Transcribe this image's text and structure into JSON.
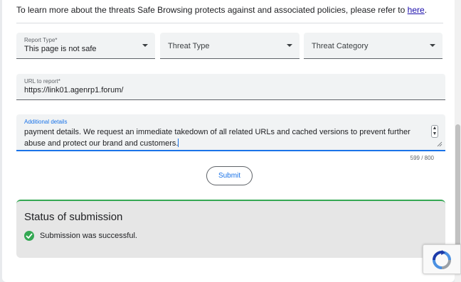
{
  "intro": {
    "text": "To learn more about the threats Safe Browsing protects against and associated policies, please refer to ",
    "link": "here",
    "suffix": "."
  },
  "form": {
    "report_type": {
      "label": "Report Type*",
      "value": "This page is not safe"
    },
    "threat_type": {
      "placeholder": "Threat Type"
    },
    "threat_category": {
      "placeholder": "Threat Category"
    },
    "url": {
      "label": "URL to report*",
      "value": "https://link01.agenrp1.forum/"
    },
    "details": {
      "label": "Additional details",
      "value": "payment details. We request an immediate takedown of all related URLs and cached versions to prevent further abuse and protect our brand and customers.",
      "counter": "599 / 800"
    },
    "submit_label": "Submit"
  },
  "status": {
    "title": "Status of submission",
    "message": "Submission was successful.",
    "icon": "check-circle-icon",
    "color": "#34a853"
  },
  "colors": {
    "accent": "#1a73e8",
    "link": "#1a0dab"
  }
}
